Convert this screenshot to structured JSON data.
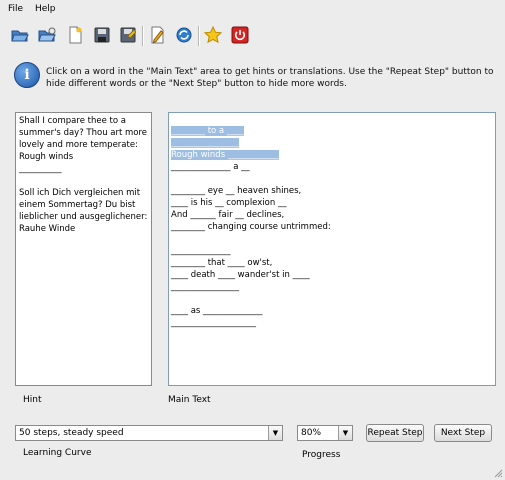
{
  "menu": {
    "file": "File",
    "help": "Help"
  },
  "toolbar": {
    "icons": [
      "open-folder-icon",
      "open-file-icon",
      "new-document-icon",
      "save-icon",
      "save-as-icon",
      "edit-pencil-icon",
      "refresh-icon",
      "star-icon",
      "power-icon"
    ]
  },
  "info": {
    "text": "Click on a word in the \"Main Text\" area to get hints or translations. Use the \"Repeat Step\" button to hide different words or the \"Next Step\" button to hide more words."
  },
  "hint": {
    "label": "Hint",
    "lines": [
      "Shall I compare thee to a",
      "summer's day? Thou art more",
      "lovely and more temperate:",
      "Rough winds",
      "__________",
      "",
      "Soll ich Dich vergleichen mit",
      "einem Sommertag? Du bist",
      "lieblicher und ausgeglichener:",
      "Rauhe Winde"
    ]
  },
  "main": {
    "label": "Main Text",
    "lines": [
      "________ to a ____",
      "________________",
      "Rough winds ____________",
      "______________ a __",
      "",
      "________ eye __ heaven shines,",
      "____ is his __ complexion __",
      "And ______ fair __ declines,",
      "________ changing course untrimmed:",
      "",
      "______________",
      "________ that ____ ow'st,",
      "____ death ____ wander'st in ____",
      "________________",
      "",
      "____ as ______________",
      "____________________"
    ]
  },
  "controls": {
    "learning_curve_value": "50 steps, steady speed",
    "learning_curve_label": "Learning Curve",
    "progress_value": "80%",
    "progress_label": "Progress",
    "repeat_step": "Repeat Step",
    "next_step": "Next Step"
  }
}
